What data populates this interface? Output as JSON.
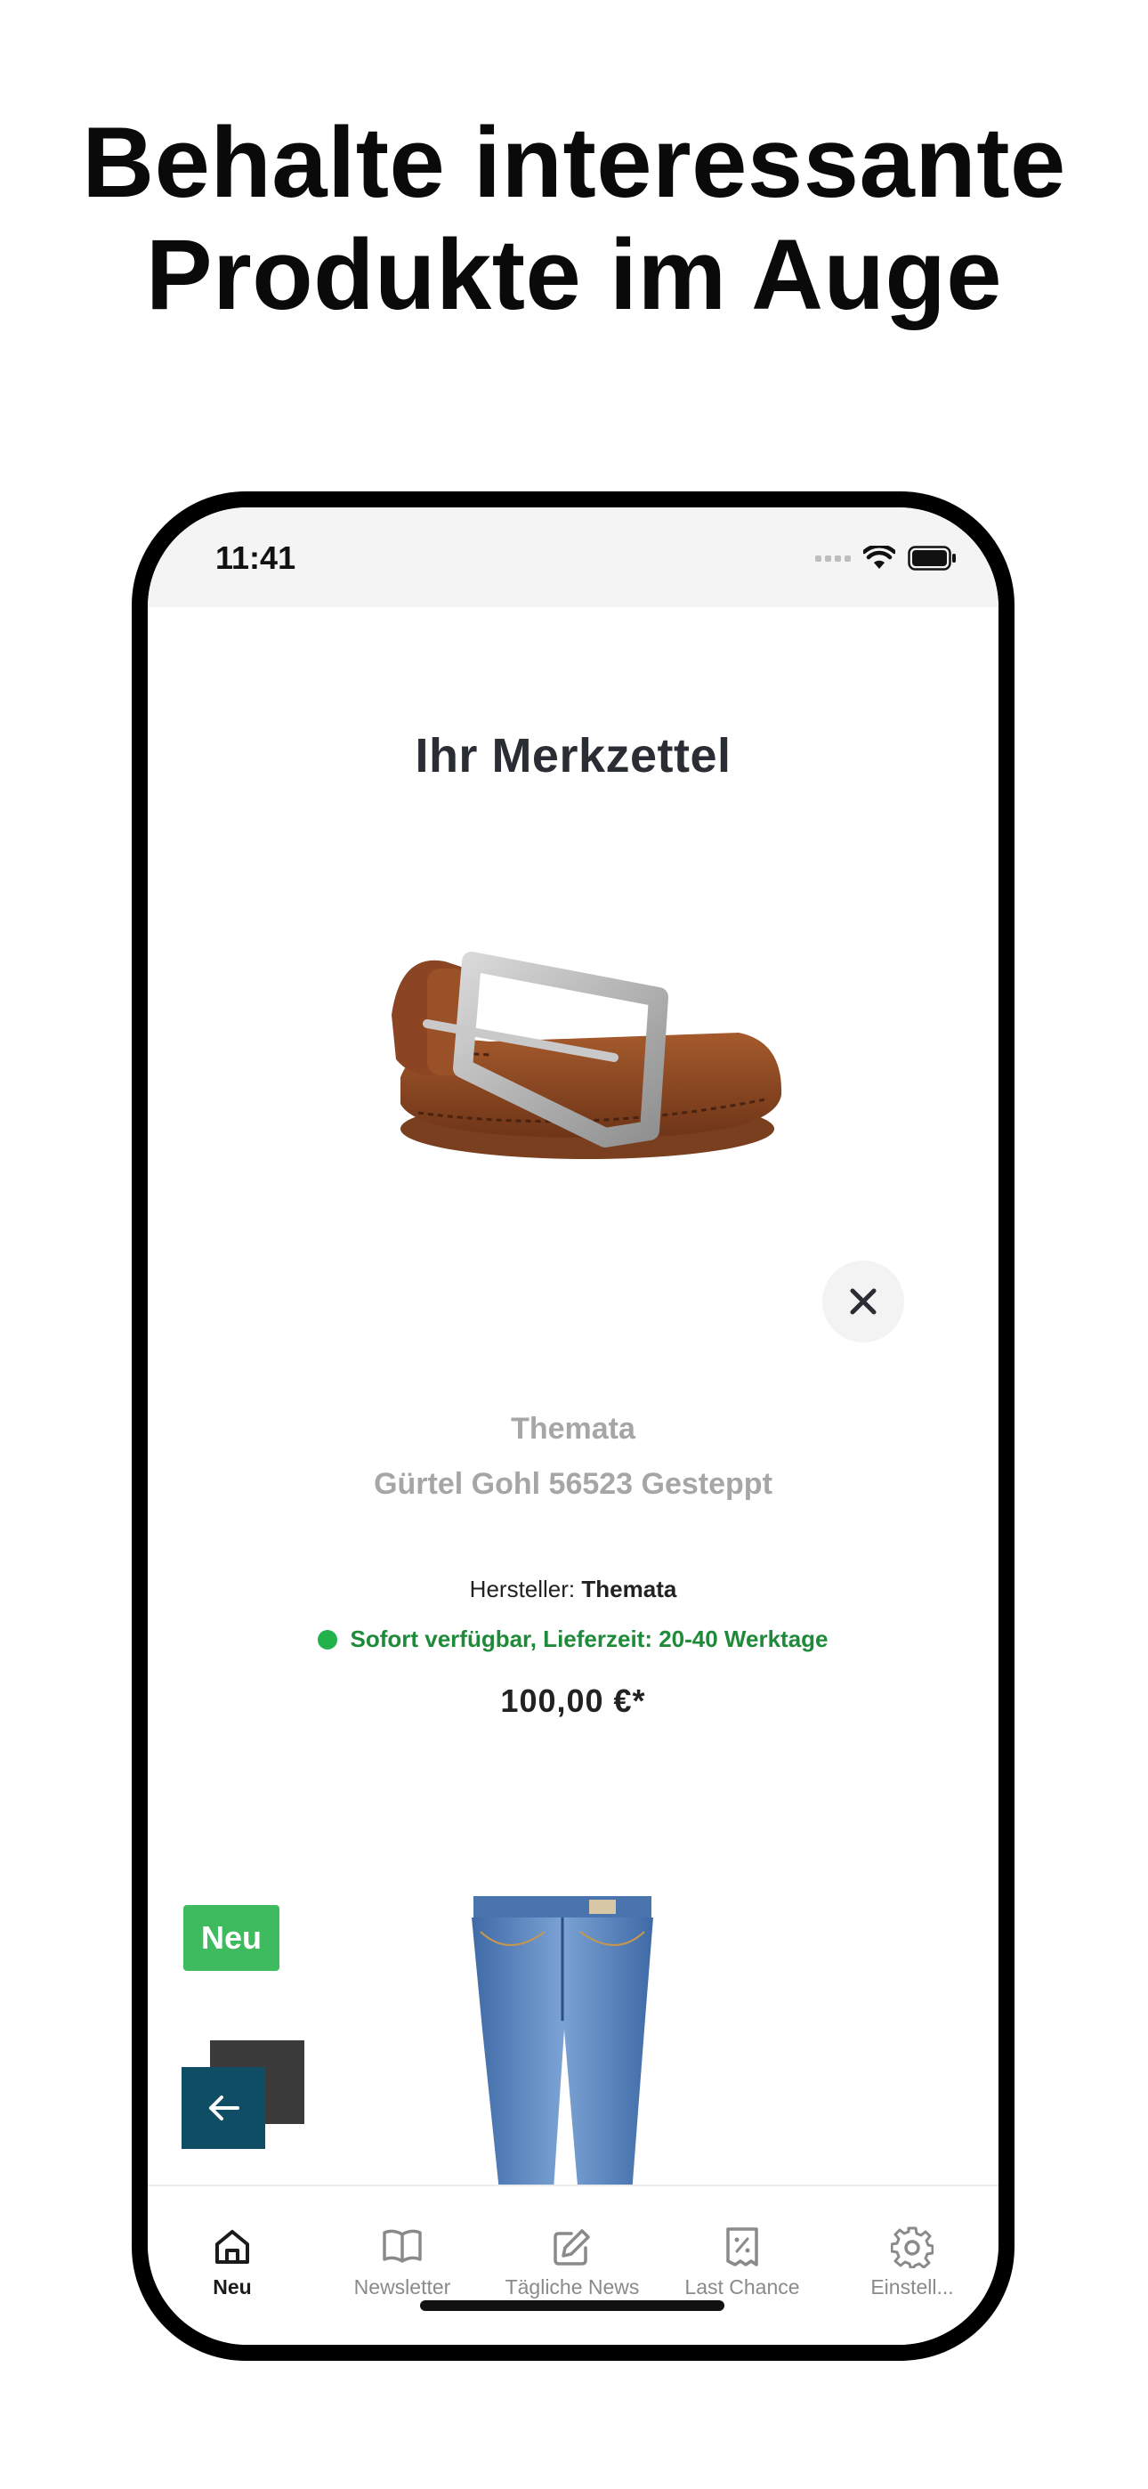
{
  "headline": {
    "line1": "Behalte interessante",
    "line2": "Produkte im Auge"
  },
  "status_bar": {
    "time": "11:41"
  },
  "page": {
    "title": "Ihr Merkzettel"
  },
  "wishlist": {
    "items": [
      {
        "image_icon": "belt-product-image",
        "brand": "Themata",
        "name": "Gürtel Gohl 56523 Gesteppt",
        "manufacturer_label": "Hersteller:",
        "manufacturer": "Themata",
        "availability": "Sofort verfügbar, Lieferzeit: 20-40 Werktage",
        "price": "100,00 €*"
      },
      {
        "image_icon": "jeans-product-image",
        "badge": "Neu"
      }
    ]
  },
  "tabbar": {
    "tabs": [
      {
        "label": "Neu",
        "icon": "home-icon",
        "active": true
      },
      {
        "label": "Newsletter",
        "icon": "book-icon",
        "active": false
      },
      {
        "label": "Tägliche News",
        "icon": "edit-icon",
        "active": false
      },
      {
        "label": "Last Chance",
        "icon": "discount-receipt-icon",
        "active": false
      },
      {
        "label": "Einstell...",
        "icon": "gear-icon",
        "active": false
      }
    ]
  },
  "colors": {
    "accent_green": "#3dbb5e",
    "availability_green": "#1f8a3a",
    "back_button": "#0e4d63"
  }
}
